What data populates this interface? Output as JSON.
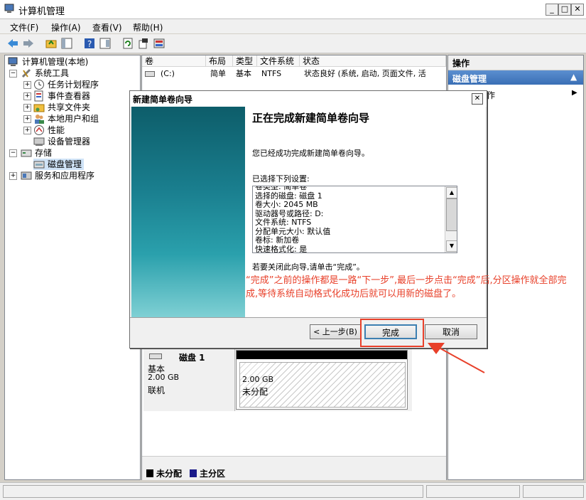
{
  "window": {
    "title": "计算机管理"
  },
  "menu": {
    "file": "文件(F)",
    "action": "操作(A)",
    "view": "查看(V)",
    "help": "帮助(H)"
  },
  "tree": {
    "root": "计算机管理(本地)",
    "system_tools": "系统工具",
    "task_scheduler": "任务计划程序",
    "event_viewer": "事件查看器",
    "shared_folders": "共享文件夹",
    "local_users": "本地用户和组",
    "performance": "性能",
    "device_manager": "设备管理器",
    "storage": "存储",
    "disk_management": "磁盘管理",
    "services_apps": "服务和应用程序"
  },
  "volume_table": {
    "headers": [
      "卷",
      "布局",
      "类型",
      "文件系统",
      "状态"
    ],
    "row": {
      "volume": "(C:)",
      "layout": "简单",
      "type": "基本",
      "fs": "NTFS",
      "status": "状态良好 (系统, 启动, 页面文件, 活"
    }
  },
  "actions": {
    "header": "操作",
    "section": "磁盘管理",
    "more": "更多操作"
  },
  "disk": {
    "name": "磁盘 1",
    "type": "基本",
    "size": "2.00 GB",
    "state": "联机",
    "partition_size": "2.00 GB",
    "partition_label": "未分配"
  },
  "legend": {
    "unallocated": "未分配",
    "primary": "主分区"
  },
  "dialog": {
    "title": "新建简单卷向导",
    "heading": "正在完成新建简单卷向导",
    "success": "您已经成功完成新建简单卷向导。",
    "selected_label": "已选择下列设置:",
    "settings": [
      "卷类型: 简单卷",
      "选择的磁盘: 磁盘 1",
      "卷大小: 2045 MB",
      "驱动器号或路径: D:",
      "文件系统: NTFS",
      "分配单元大小: 默认值",
      "卷标: 新加卷",
      "快速格式化: 是"
    ],
    "close_hint": "若要关闭此向导,请单击“完成”。",
    "back": "< 上一步(B)",
    "finish": "完成",
    "cancel": "取消"
  },
  "annotation": {
    "text": "“完成”之前的操作都是一路“下一步”,最后一步点击“完成”后,分区操作就全部完成,等待系统自动格式化成功后就可以用新的磁盘了。",
    "color": "#e8402a"
  }
}
